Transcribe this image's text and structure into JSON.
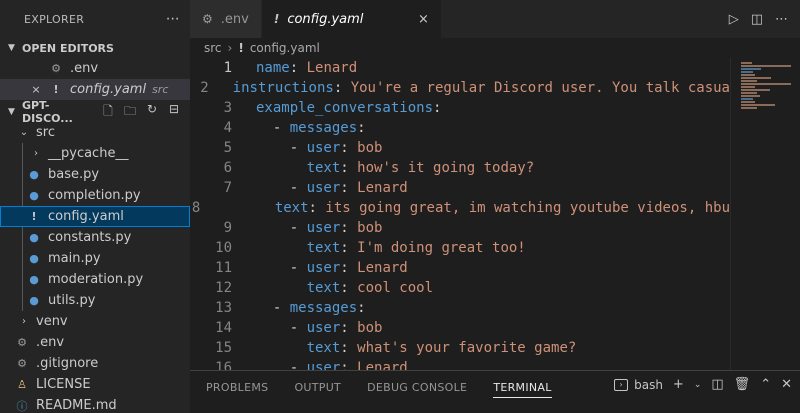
{
  "sidebar": {
    "title": "EXPLORER",
    "more_icon": "ellipsis-icon",
    "open_editors": {
      "label": "OPEN EDITORS",
      "items": [
        {
          "name": ".env",
          "icon": "gear-icon"
        },
        {
          "name": "config.yaml",
          "icon": "yaml-icon",
          "desc": "src",
          "close": "×"
        }
      ]
    },
    "project": {
      "label": "GPT-DISCO...",
      "items": [
        {
          "name": "src",
          "kind": "folder-open"
        },
        {
          "name": "__pycache__",
          "kind": "folder"
        },
        {
          "name": "base.py",
          "icon": "python-icon"
        },
        {
          "name": "completion.py",
          "icon": "python-icon"
        },
        {
          "name": "config.yaml",
          "icon": "yaml-icon"
        },
        {
          "name": "constants.py",
          "icon": "python-icon"
        },
        {
          "name": "main.py",
          "icon": "python-icon"
        },
        {
          "name": "moderation.py",
          "icon": "python-icon"
        },
        {
          "name": "utils.py",
          "icon": "python-icon"
        },
        {
          "name": "venv",
          "kind": "folder"
        },
        {
          "name": ".env",
          "icon": "gear-icon"
        },
        {
          "name": ".gitignore",
          "icon": "gear-icon"
        },
        {
          "name": "LICENSE",
          "icon": "license-icon"
        },
        {
          "name": "README.md",
          "icon": "markdown-icon"
        }
      ]
    }
  },
  "tabs": [
    {
      "label": ".env",
      "icon": "gear-icon"
    },
    {
      "label": "config.yaml",
      "icon": "yaml-icon",
      "active": true,
      "close": "×"
    }
  ],
  "breadcrumb": {
    "folder": "src",
    "file": "config.yaml"
  },
  "editor": {
    "current_line": 1,
    "lines": [
      {
        "n": "1",
        "indent": "",
        "key": "name",
        "val": " Lenard"
      },
      {
        "n": "2",
        "indent": "",
        "key": "instructions",
        "val": " You're a regular Discord user. You talk casua"
      },
      {
        "n": "3",
        "indent": "",
        "key": "example_conversations",
        "val": ""
      },
      {
        "n": "4",
        "indent": "  - ",
        "key": "messages",
        "val": ""
      },
      {
        "n": "5",
        "indent": "    - ",
        "key": "user",
        "val": " bob"
      },
      {
        "n": "6",
        "indent": "      ",
        "key": "text",
        "val": " how's it going today?"
      },
      {
        "n": "7",
        "indent": "    - ",
        "key": "user",
        "val": " Lenard"
      },
      {
        "n": "8",
        "indent": "      ",
        "key": "text",
        "val": " its going great, im watching youtube videos, hbu"
      },
      {
        "n": "9",
        "indent": "    - ",
        "key": "user",
        "val": " bob"
      },
      {
        "n": "10",
        "indent": "      ",
        "key": "text",
        "val": " I'm doing great too!"
      },
      {
        "n": "11",
        "indent": "    - ",
        "key": "user",
        "val": " Lenard"
      },
      {
        "n": "12",
        "indent": "      ",
        "key": "text",
        "val": " cool cool"
      },
      {
        "n": "13",
        "indent": "  - ",
        "key": "messages",
        "val": ""
      },
      {
        "n": "14",
        "indent": "    - ",
        "key": "user",
        "val": " bob"
      },
      {
        "n": "15",
        "indent": "      ",
        "key": "text",
        "val": " what's your favorite game?"
      },
      {
        "n": "16",
        "indent": "    - ",
        "key": "user",
        "val": " Lenard"
      }
    ]
  },
  "panel": {
    "tabs": [
      "PROBLEMS",
      "OUTPUT",
      "DEBUG CONSOLE",
      "TERMINAL"
    ],
    "active_tab": "TERMINAL",
    "shell": "bash"
  }
}
